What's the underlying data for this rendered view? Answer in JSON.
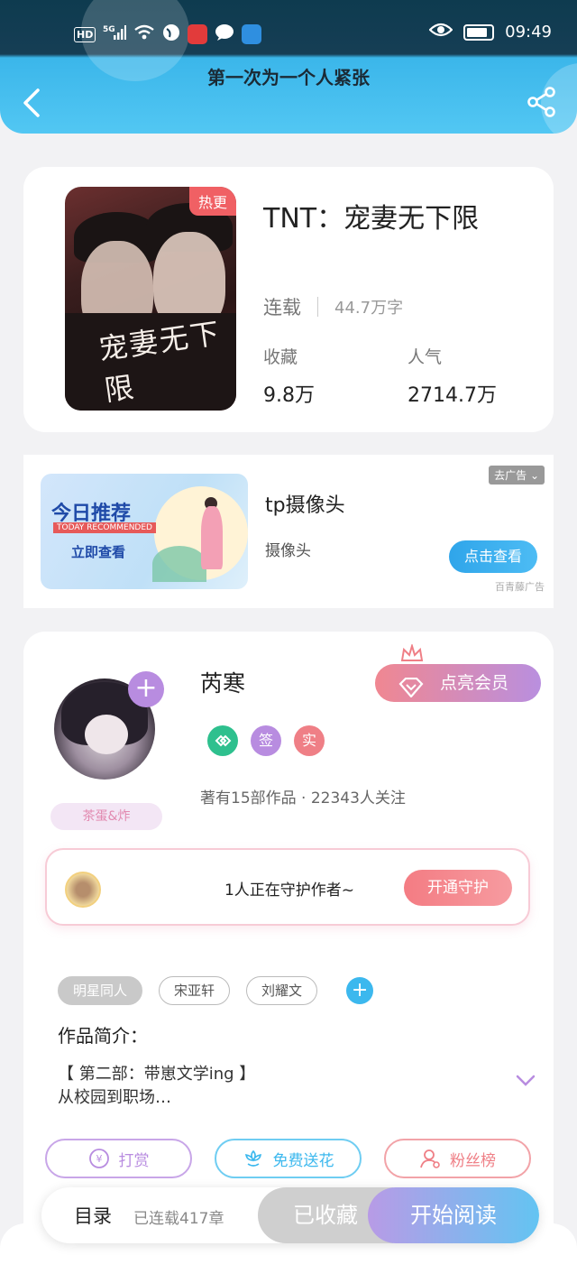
{
  "status_bar": {
    "network": "5G",
    "hd": "HD",
    "time": "09:49"
  },
  "nav": {
    "title": "第一次为一个人紧张"
  },
  "book": {
    "cover_tag": "热更",
    "cover_art_text": "宠妻无下限",
    "title": "TNT：宠妻无下限",
    "status": "连载",
    "word_count": "44.7万字",
    "favorites_label": "收藏",
    "favorites_value": "9.8万",
    "popularity_label": "人气",
    "popularity_value": "2714.7万"
  },
  "ad": {
    "banner_title": "今日推荐",
    "banner_sub": "TODAY RECOMMENDED",
    "banner_cta": "立即查看",
    "title": "tp摄像头",
    "subtitle": "摄像头",
    "remove_label": "去广告",
    "button_label": "点击查看",
    "source": "百青藤广告"
  },
  "author": {
    "name": "芮寒",
    "vip_label": "点亮会员",
    "badge_sign": "签",
    "badge_real": "实",
    "stats": "著有15部作品 · 22343人关注",
    "nickname_tag": "茶蛋&炸",
    "guard_text": "1人正在守护作者~",
    "guard_button": "开通守护",
    "tags": [
      "明星同人",
      "宋亚轩",
      "刘耀文"
    ],
    "intro_label": "作品简介：",
    "intro_lines": [
      "【 第二部：带崽文学ing 】",
      "从校园到职场…"
    ],
    "actions": {
      "tip": "打赏",
      "flower": "免费送花",
      "fans": "粉丝榜"
    }
  },
  "bottom_bar": {
    "toc_label": "目录",
    "chapters": "已连载417章",
    "collected_label": "已收藏",
    "read_label": "开始阅读"
  },
  "colors": {
    "header_accent": "#52c7f3",
    "vip_gradient_start": "#f08791",
    "read_gradient_end": "#63c4f2",
    "tip_color": "#b88ce0",
    "flower_color": "#3cb8ee",
    "fans_color": "#ef7f86"
  }
}
